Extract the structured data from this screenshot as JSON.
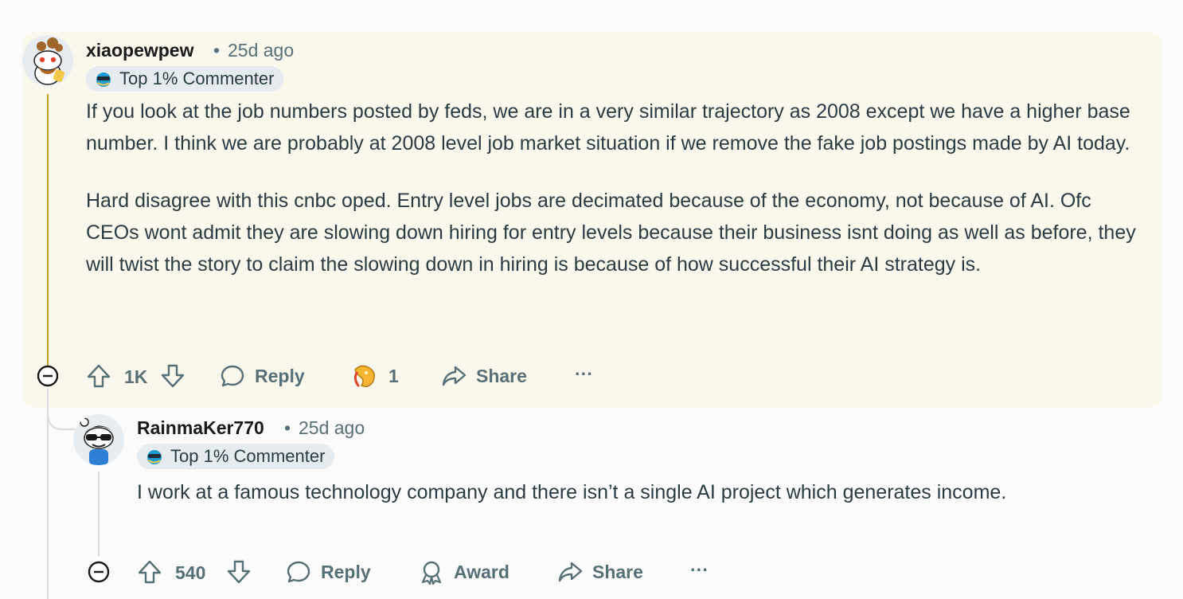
{
  "comments": [
    {
      "username": "xiaopewpew",
      "separator": "•",
      "time": "25d ago",
      "badge": "Top 1% Commenter",
      "paragraphs": [
        "If you look at the job numbers posted by feds, we are in a very similar trajectory as 2008 except we have a higher base number. I think we are probably at 2008 level job market situation if we remove the fake job postings made by AI today.",
        "Hard disagree with this cnbc oped. Entry level jobs are decimated because of the economy, not because of AI. Ofc CEOs wont admit they are slowing down hiring for entry levels because their business isnt doing as well as before, they will twist the story to claim the slowing down in hiring is because of how successful their AI strategy is."
      ],
      "votes": "1K",
      "reply_label": "Reply",
      "award_count": "1",
      "share_label": "Share",
      "more_label": "···"
    },
    {
      "username": "RainmaKer770",
      "separator": "•",
      "time": "25d ago",
      "badge": "Top 1% Commenter",
      "paragraphs": [
        "I work at a famous technology company and there isn’t a single AI project which generates income."
      ],
      "votes": "540",
      "reply_label": "Reply",
      "award_label": "Award",
      "share_label": "Share",
      "more_label": "···"
    }
  ],
  "colors": {
    "highlight_bg": "#faf7ec",
    "thread_gold": "#c8a227",
    "thread_gray": "#d8dadc",
    "meta_text": "#576f76"
  }
}
